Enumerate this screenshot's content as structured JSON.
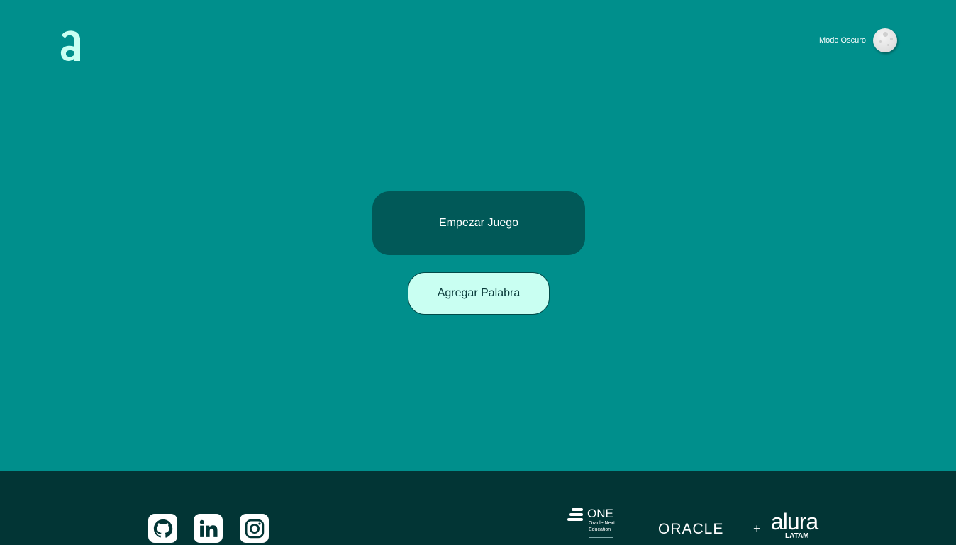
{
  "header": {
    "logo_letter": "a",
    "dark_mode_label": "Modo Oscuro",
    "moon_icon": "moon-icon"
  },
  "main": {
    "start_button_label": "Empezar Juego",
    "add_word_button_label": "Agregar Palabra"
  },
  "footer": {
    "social_links": [
      {
        "name": "github-icon"
      },
      {
        "name": "linkedin-icon"
      },
      {
        "name": "instagram-icon"
      }
    ],
    "one_logo": {
      "title": "ONE",
      "line1": "Oracle Next",
      "line2": "Education"
    },
    "partners": {
      "oracle": "ORACLE",
      "plus": "+",
      "alura": "alura",
      "alura_sub": "LATAM"
    }
  },
  "colors": {
    "background": "#008f8c",
    "accent_logo": "#c9fff2",
    "start_button": "#015958",
    "add_button": "#c9fff2",
    "footer": "#023535"
  }
}
